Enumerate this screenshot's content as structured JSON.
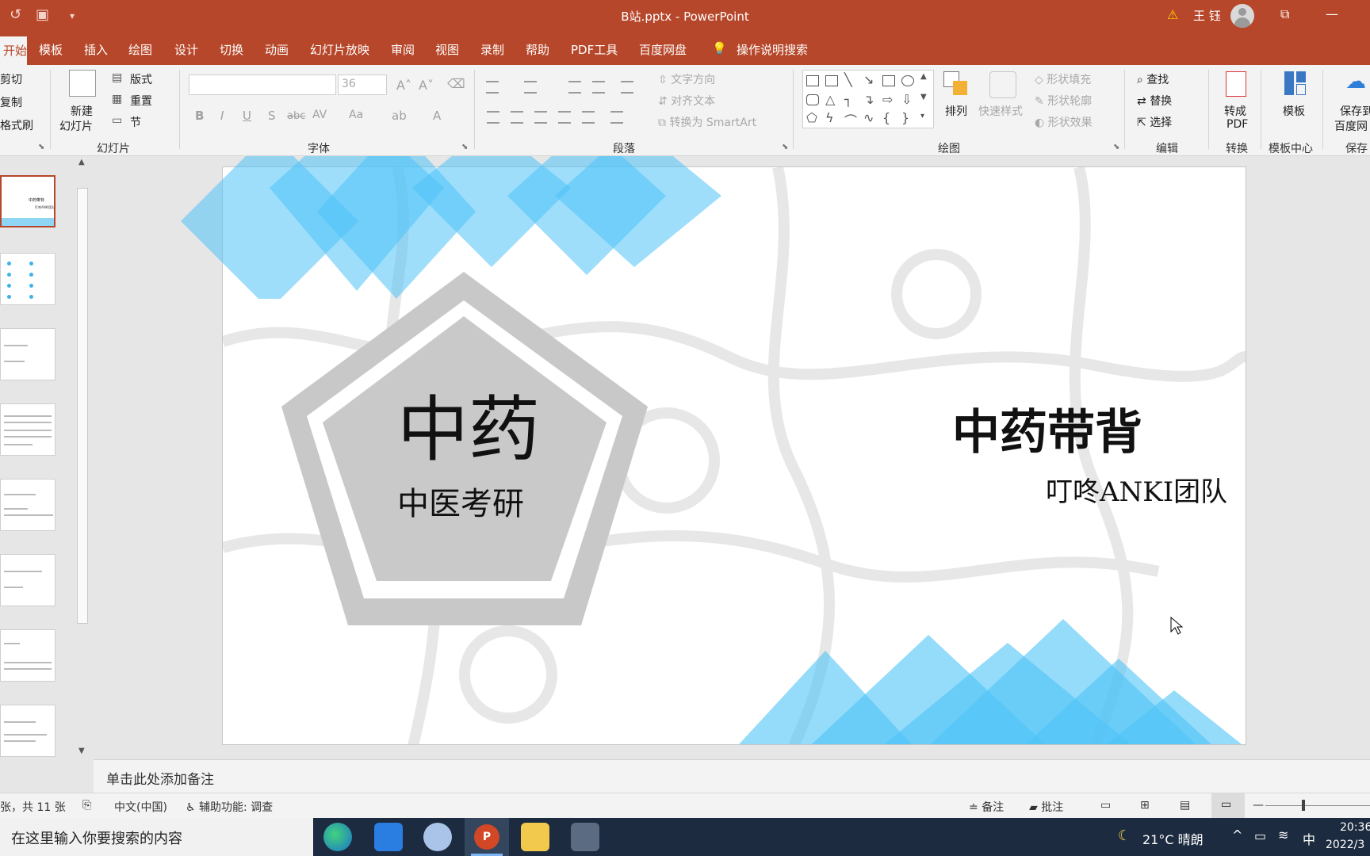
{
  "titlebar": {
    "title": "B站.pptx  -  PowerPoint",
    "user": "王 钰",
    "min_icon": "—",
    "restore_icon": "⧉"
  },
  "menu": {
    "home_partial": "开始",
    "items": [
      "模板",
      "插入",
      "绘图",
      "设计",
      "切换",
      "动画",
      "幻灯片放映",
      "审阅",
      "视图",
      "录制",
      "帮助",
      "PDF工具",
      "百度网盘"
    ],
    "search": "操作说明搜索"
  },
  "ribbon": {
    "clipboard": {
      "cut": "剪切",
      "copy": "复制",
      "format_painter": "格式刷"
    },
    "slides": {
      "new_slide_1": "新建",
      "new_slide_2": "幻灯片",
      "layout": "版式",
      "reset": "重置",
      "section": "节",
      "group_label": "幻灯片"
    },
    "font": {
      "size": "36",
      "group_label": "字体",
      "bold": "B",
      "italic": "I",
      "underline": "U",
      "shadow": "S",
      "strike": "abc",
      "spacing": "AV",
      "case": "Aa",
      "color": "A"
    },
    "paragraph": {
      "text_direction": "文字方向",
      "align_text": "对齐文本",
      "smartart": "转换为 SmartArt",
      "group_label": "段落"
    },
    "drawing": {
      "arrange": "排列",
      "quick_styles": "快速样式",
      "shape_fill": "形状填充",
      "shape_outline": "形状轮廓",
      "shape_effects": "形状效果",
      "group_label": "绘图"
    },
    "editing": {
      "find": "查找",
      "replace": "替换",
      "select": "选择",
      "group_label": "编辑"
    },
    "convert": {
      "label_1": "转成",
      "label_2": "PDF",
      "group_label": "转换"
    },
    "template": {
      "label": "模板",
      "group_label": "模板中心"
    },
    "save": {
      "label_1": "保存到",
      "label_2": "百度网",
      "group_label": "保存"
    }
  },
  "slide": {
    "pentagon_title": "中药",
    "pentagon_subtitle": "中医考研",
    "title": "中药带背",
    "subtitle": "叮咚ANKI团队"
  },
  "thumb_mini": {
    "title": "中药带背",
    "subtitle": "叮咚ANKI团队"
  },
  "notes": {
    "placeholder": "单击此处添加备注"
  },
  "status": {
    "slide_count": "张，共 11 张",
    "language": "中文(中国)",
    "accessibility": "辅助功能: 调查",
    "notes": "备注",
    "comments": "批注",
    "zoom_minus": "—"
  },
  "taskbar": {
    "search_placeholder": "在这里输入你要搜索的内容",
    "weather": "21°C  晴朗",
    "ime": "中",
    "time": "20:36",
    "date": "2022/3"
  },
  "colors": {
    "accent": "#b7472a",
    "slide_blue": "#4fc3f7",
    "pentagon_gray": "#c8c8c8"
  }
}
